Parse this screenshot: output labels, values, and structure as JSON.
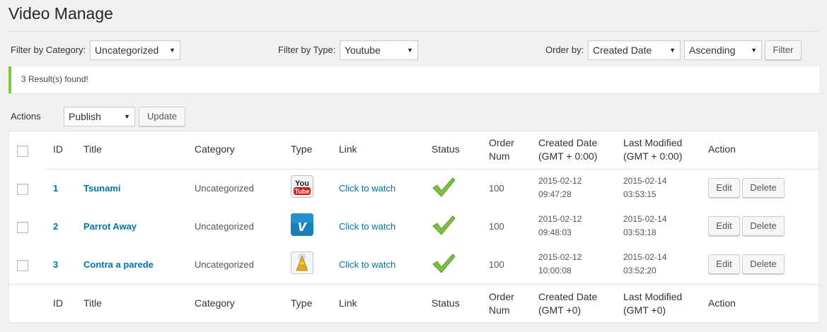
{
  "page": {
    "title": "Video Manage"
  },
  "filters": {
    "category_label": "Filter by Category:",
    "category_value": "Uncategorized",
    "type_label": "Filter by Type:",
    "type_value": "Youtube",
    "order_label": "Order by:",
    "order_value": "Created Date",
    "direction_value": "Ascending",
    "filter_button": "Filter"
  },
  "notice": {
    "text": "3 Result(s) found!"
  },
  "bulk": {
    "label": "Actions",
    "value": "Publish",
    "update_button": "Update"
  },
  "table": {
    "header": {
      "id": "ID",
      "title": "Title",
      "category": "Category",
      "type": "Type",
      "link": "Link",
      "status": "Status",
      "order_1": "Order",
      "order_2": "Num",
      "created_1": "Created Date",
      "created_2": "(GMT + 0:00)",
      "modified_1": "Last Modified",
      "modified_2": "(GMT + 0:00)",
      "action": "Action"
    },
    "footer": {
      "id": "ID",
      "title": "Title",
      "category": "Category",
      "type": "Type",
      "link": "Link",
      "status": "Status",
      "order_1": "Order",
      "order_2": "Num",
      "created_1": "Created Date",
      "created_2": "(GMT +0)",
      "modified_1": "Last Modified",
      "modified_2": "(GMT +0)",
      "action": "Action"
    },
    "rows": [
      {
        "id": "1",
        "title": "Tsunami",
        "category": "Uncategorized",
        "type_icon": "youtube-icon",
        "link": "Click to watch",
        "status_icon": "check-icon",
        "order": "100",
        "created_date": "2015-02-12",
        "created_time": "09:47:28",
        "modified_date": "2015-02-14",
        "modified_time": "03:53:15",
        "edit": "Edit",
        "delete": "Delete"
      },
      {
        "id": "2",
        "title": "Parrot Away",
        "category": "Uncategorized",
        "type_icon": "vimeo-icon",
        "link": "Click to watch",
        "status_icon": "check-icon",
        "order": "100",
        "created_date": "2015-02-12",
        "created_time": "09:48:03",
        "modified_date": "2015-02-14",
        "modified_time": "03:53:18",
        "edit": "Edit",
        "delete": "Delete"
      },
      {
        "id": "3",
        "title": "Contra a parede",
        "category": "Uncategorized",
        "type_icon": "media-file-icon",
        "link": "Click to watch",
        "status_icon": "check-icon",
        "order": "100",
        "created_date": "2015-02-12",
        "created_time": "10:00:08",
        "modified_date": "2015-02-14",
        "modified_time": "03:52:20",
        "edit": "Edit",
        "delete": "Delete"
      }
    ]
  },
  "colors": {
    "link": "#0073aa",
    "notice_border": "#7ad03a",
    "status_check": "#7ac142"
  }
}
